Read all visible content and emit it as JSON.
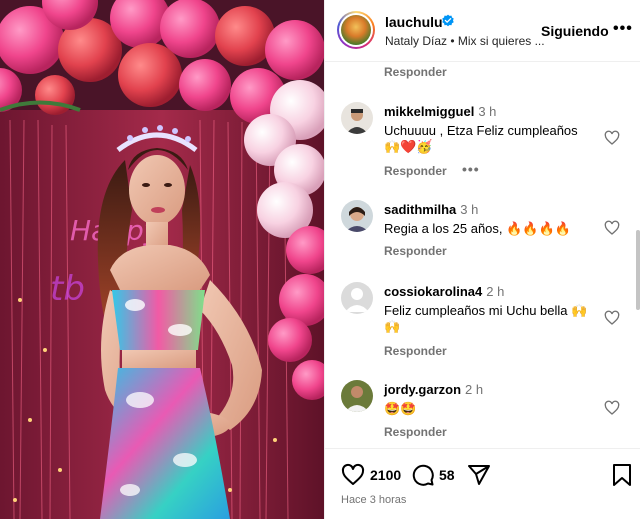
{
  "header": {
    "username": "lauchulu",
    "subtitle": "Nataly Díaz • Mix si quieres ...",
    "follow_label": "Siguiendo",
    "more_label": "•••"
  },
  "comments_section": {
    "top_reply_label": "Responder",
    "comments": [
      {
        "username": "mikkelmigguel",
        "time": "3 h",
        "text": "Uchuuuu , Etza Feliz cumpleaños",
        "emoji_line": "🙌❤️🥳",
        "reply_label": "Responder",
        "more_label": "•••"
      },
      {
        "username": "sadithmilha",
        "time": "3 h",
        "text": "Regia a los 25 años, 🔥🔥🔥🔥",
        "reply_label": "Responder"
      },
      {
        "username": "cossiokarolina4",
        "time": "2 h",
        "text": "Feliz cumpleaños mi Uchu bella 🙌",
        "emoji_line": "🙌",
        "reply_label": "Responder"
      },
      {
        "username": "jordy.garzon",
        "time": "2 h",
        "text": "🤩🤩",
        "reply_label": "Responder"
      }
    ]
  },
  "actions": {
    "likes": "2100",
    "comments_count": "58",
    "timestamp": "Hace 3 horas"
  },
  "icons": {
    "verified": "verified-badge-icon",
    "like": "heart-icon",
    "comment": "comment-bubble-icon",
    "share": "paper-plane-icon",
    "save": "bookmark-icon"
  },
  "colors": {
    "verified_blue": "#0095f6",
    "muted_text": "#737373",
    "divider": "#efefef"
  }
}
